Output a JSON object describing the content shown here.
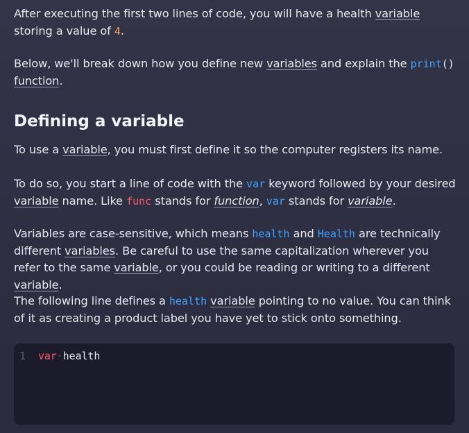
{
  "p1": {
    "t1": "After executing the first two lines of code, you will have a health ",
    "term1": "variable",
    "t2": " storing a value of ",
    "num": "4",
    "t3": "."
  },
  "p2": {
    "t1": "Below, we'll break down how you define new ",
    "term1": "variables",
    "t2": " and explain the ",
    "code_print": "print",
    "code_parens": "()",
    "t3": " ",
    "term2": "function",
    "t4": "."
  },
  "heading": "Defining a variable",
  "p3": {
    "t1": "To use a ",
    "term1": "variable",
    "t2": ", you must first define it so the computer registers its name."
  },
  "p4": {
    "t1": "To do so, you start a line of code with the ",
    "code_var": "var",
    "t2": " keyword followed by your desired ",
    "term1": "variable",
    "t3": " name. Like ",
    "code_func": "func",
    "t4": " stands for ",
    "term2": "function",
    "t5": ", ",
    "code_var2": "var",
    "t6": " stands for ",
    "term3": "variable",
    "t7": "."
  },
  "p5": {
    "t1": "Variables are case-sensitive, which means ",
    "code_health": "health",
    "t2": " and ",
    "code_Health": "Health",
    "t3": " are technically different ",
    "term1": "variables",
    "t4": ". Be careful to use the same capitalization wherever you refer to the same ",
    "term2": "variable",
    "t5": ", or you could be reading or writing to a different ",
    "term3": "variable",
    "t6": "."
  },
  "p6": {
    "t1": "The following line defines a ",
    "code_health": "health",
    "t2": " ",
    "term1": "variable",
    "t3": " pointing to no value. You can think of it as creating a product label you have yet to stick onto something."
  },
  "code_block": {
    "line_number": "1",
    "keyword": "var",
    "space_marker": "·",
    "identifier": "health"
  },
  "colors": {
    "background": "#2e2f42",
    "code_background": "#1b1b2c",
    "text": "#e6e7ef",
    "code_blue": "#3fa3ff",
    "code_red": "#ff5a6e",
    "number_orange": "#f2a25c"
  }
}
